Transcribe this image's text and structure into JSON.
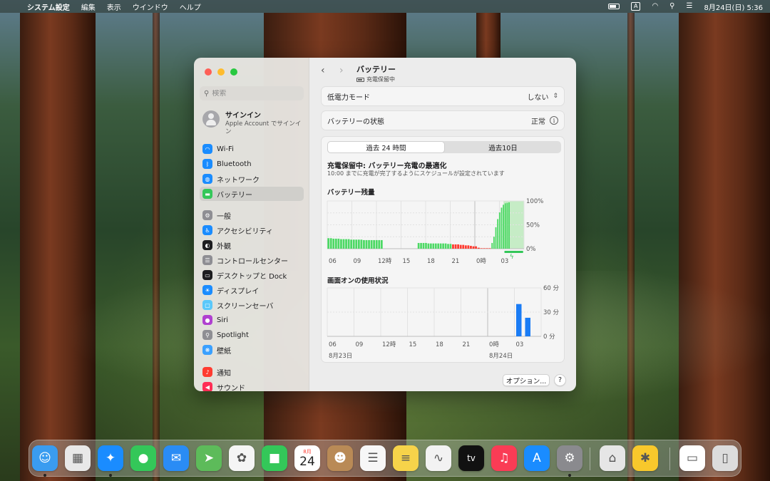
{
  "menubar": {
    "app_name": "システム設定",
    "menus": [
      "編集",
      "表示",
      "ウインドウ",
      "ヘルプ"
    ],
    "input_indicator": "A",
    "clock": "8月24日(日)  5:36"
  },
  "sidebar": {
    "search_placeholder": "検索",
    "signin_title": "サインイン",
    "signin_subtitle": "Apple Account でサインイン",
    "items": [
      {
        "label": "Wi-Fi",
        "color": "#1a8cff",
        "icon": "wifi-icon"
      },
      {
        "label": "Bluetooth",
        "color": "#1a8cff",
        "icon": "bluetooth-icon"
      },
      {
        "label": "ネットワーク",
        "color": "#1a8cff",
        "icon": "globe-icon"
      },
      {
        "label": "バッテリー",
        "color": "#34c759",
        "icon": "battery-icon",
        "selected": true
      },
      {
        "label": "一般",
        "color": "#8e8e93",
        "icon": "gear-icon"
      },
      {
        "label": "アクセシビリティ",
        "color": "#1a8cff",
        "icon": "accessibility-icon"
      },
      {
        "label": "外観",
        "color": "#1d1d1f",
        "icon": "appearance-icon"
      },
      {
        "label": "コントロールセンター",
        "color": "#8e8e93",
        "icon": "control-center-icon"
      },
      {
        "label": "デスクトップと Dock",
        "color": "#1d1d1f",
        "icon": "dock-icon"
      },
      {
        "label": "ディスプレイ",
        "color": "#1a8cff",
        "icon": "display-icon"
      },
      {
        "label": "スクリーンセーバ",
        "color": "#5ac8fa",
        "icon": "screensaver-icon"
      },
      {
        "label": "Siri",
        "color": "#b040d0",
        "icon": "siri-icon"
      },
      {
        "label": "Spotlight",
        "color": "#8e8e93",
        "icon": "spotlight-icon"
      },
      {
        "label": "壁紙",
        "color": "#3aa0ff",
        "icon": "wallpaper-icon"
      },
      {
        "label": "通知",
        "color": "#ff3b30",
        "icon": "bell-icon"
      },
      {
        "label": "サウンド",
        "color": "#ff2d55",
        "icon": "speaker-icon"
      }
    ]
  },
  "header": {
    "title": "バッテリー",
    "subtitle": "充電保留中"
  },
  "low_power": {
    "label": "低電力モード",
    "value": "しない"
  },
  "battery_health": {
    "label": "バッテリーの状態",
    "value": "正常"
  },
  "tabs": [
    {
      "label": "過去 24 時間",
      "active": true
    },
    {
      "label": "過去10日",
      "active": false
    }
  ],
  "charging": {
    "title": "充電保留中: バッテリー充電の最適化",
    "subtitle": "10:00 までに充電が完了するようにスケジュールが設定されています"
  },
  "chart_data": [
    {
      "type": "bar",
      "title": "バッテリー残量",
      "x_ticks": [
        "06",
        "09",
        "12時",
        "15",
        "18",
        "21",
        "0時",
        "03"
      ],
      "y_ticks": [
        "100%",
        "50%",
        "0%"
      ],
      "ylim": [
        0,
        100
      ],
      "segments": [
        {
          "start": 0,
          "end": 6.8,
          "values": [
            22,
            22,
            21,
            21,
            21,
            20,
            20,
            20,
            20,
            19,
            19,
            19,
            19,
            19,
            18,
            18,
            18,
            18,
            18,
            18,
            18,
            18
          ],
          "color": "#4cd964"
        },
        {
          "start": 11,
          "end": 15.2,
          "values": [
            12,
            12,
            12,
            12,
            11,
            11,
            11,
            11,
            11,
            11,
            11,
            11,
            10,
            10
          ],
          "color": "#4cd964"
        },
        {
          "start": 15.2,
          "end": 18.3,
          "values": [
            9,
            9,
            9,
            8,
            8,
            7,
            7,
            6,
            5,
            5
          ],
          "color": "#ff3b30"
        },
        {
          "start": 18.3,
          "end": 20,
          "values": [
            2,
            1,
            1,
            1,
            1
          ],
          "color": "#ff3b30"
        },
        {
          "start": 20,
          "end": 22.3,
          "values": [
            12,
            25,
            45,
            62,
            76,
            86,
            92,
            95,
            96,
            97
          ],
          "color": "#4cd964"
        }
      ]
    },
    {
      "type": "bar",
      "title": "画面オンの使用状況",
      "x_ticks": [
        "06",
        "09",
        "12時",
        "15",
        "18",
        "21",
        "0時",
        "03"
      ],
      "date_labels": [
        "8月23日",
        "8月24日"
      ],
      "y_ticks": [
        "60 分",
        "30 分",
        "0 分"
      ],
      "ylim": [
        0,
        60
      ],
      "bars": [
        {
          "hour": 21,
          "value": 40
        },
        {
          "hour": 22,
          "value": 23
        }
      ],
      "color": "#1a7cf5"
    }
  ],
  "footer": {
    "options_label": "オプション...",
    "help_label": "?"
  },
  "dock": {
    "calendar_month": "8月",
    "calendar_day": "24",
    "apps": [
      {
        "name": "finder-icon",
        "color": "#3a9cf0",
        "glyph": "☺",
        "running": true
      },
      {
        "name": "launchpad-icon",
        "color": "#e8e8e8",
        "glyph": "▦",
        "running": false
      },
      {
        "name": "safari-icon",
        "color": "#1a8cff",
        "glyph": "✦",
        "running": true
      },
      {
        "name": "messages-icon",
        "color": "#34c759",
        "glyph": "●",
        "running": false
      },
      {
        "name": "mail-icon",
        "color": "#2a8cf5",
        "glyph": "✉",
        "running": false
      },
      {
        "name": "maps-icon",
        "color": "#5dbb5a",
        "glyph": "➤",
        "running": false
      },
      {
        "name": "photos-icon",
        "color": "#f5f5f5",
        "glyph": "✿",
        "running": false
      },
      {
        "name": "facetime-icon",
        "color": "#34c759",
        "glyph": "■",
        "running": false
      },
      {
        "name": "calendar-icon",
        "color": "#ffffff",
        "glyph": "",
        "running": false
      },
      {
        "name": "contacts-icon",
        "color": "#b98a56",
        "glyph": "☻",
        "running": false
      },
      {
        "name": "reminders-icon",
        "color": "#f7f7f7",
        "glyph": "☰",
        "running": false
      },
      {
        "name": "notes-icon",
        "color": "#f6d34a",
        "glyph": "≡",
        "running": false
      },
      {
        "name": "freeform-icon",
        "color": "#f2f2f2",
        "glyph": "∿",
        "running": false
      },
      {
        "name": "apple-tv-icon",
        "color": "#111111",
        "glyph": "tv",
        "running": false
      },
      {
        "name": "music-icon",
        "color": "#fa3c55",
        "glyph": "♫",
        "running": false
      },
      {
        "name": "app-store-icon",
        "color": "#1a8cff",
        "glyph": "A",
        "running": false
      },
      {
        "name": "system-settings-icon",
        "color": "#8a8a8e",
        "glyph": "⚙",
        "running": true
      },
      {
        "name": "system-information-icon",
        "color": "#e6e6e6",
        "glyph": "⌂",
        "running": false
      },
      {
        "name": "tips-icon",
        "color": "#f8c82c",
        "glyph": "✱",
        "running": false
      },
      {
        "name": "preview-icon",
        "color": "#ffffff",
        "glyph": "▭",
        "running": false
      },
      {
        "name": "trash-icon",
        "color": "#dcdcdc",
        "glyph": "▯",
        "running": false
      }
    ]
  }
}
